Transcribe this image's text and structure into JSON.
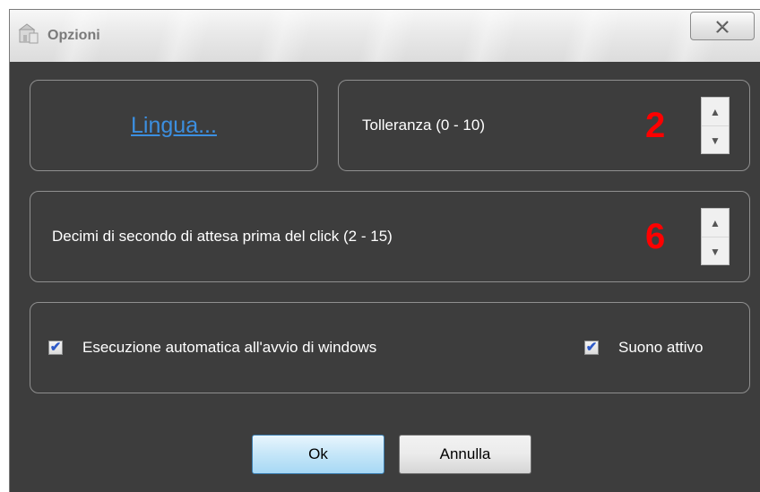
{
  "window": {
    "title": "Opzioni",
    "close_glyph": "☒"
  },
  "lingua": {
    "label": "Lingua..."
  },
  "tolleranza": {
    "label": "Tolleranza (0 - 10)",
    "value": "2"
  },
  "decimi": {
    "label": "Decimi di secondo di attesa prima del click (2 - 15)",
    "value": "6"
  },
  "options": {
    "autostart_label": "Esecuzione automatica all'avvio di windows",
    "autostart_checked": true,
    "sound_label": "Suono attivo",
    "sound_checked": true
  },
  "buttons": {
    "ok": "Ok",
    "cancel": "Annulla"
  },
  "icons": {
    "app": "app-icon",
    "up": "spin-up-icon",
    "down": "spin-down-icon",
    "check": "checkmark-icon"
  },
  "colors": {
    "accent_number": "#ff0000",
    "link": "#3c8fe0",
    "background": "#3d3d3d"
  }
}
